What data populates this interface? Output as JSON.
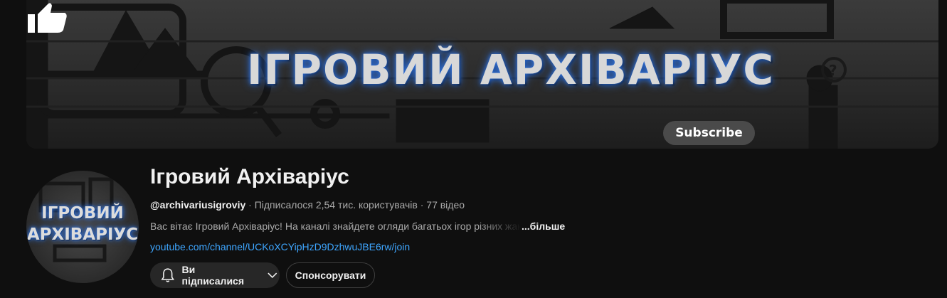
{
  "banner": {
    "title": "ІГРОВИЙ АРХІВАРІУС",
    "subscribe_label": "Subscribe"
  },
  "avatar": {
    "line1": "ІГРОВИЙ",
    "line2": "АРХІВАРІУС"
  },
  "channel": {
    "name": "Ігровий Архіваріус",
    "handle": "@archivariusigroviy",
    "separator": " · ",
    "subscribers": "Підписалося 2,54 тис. користувачів",
    "videos": "77 відео",
    "description": "Вас вітає Ігровий Архіваріус! На каналі знайдете огляди багатьох ігор різних жанрів",
    "more_label": "...більше",
    "link": "youtube.com/channel/UCKoXCYipHzD9DzhwuJBE6rw/join"
  },
  "actions": {
    "subscribed_label": "Ви підписалися",
    "sponsor_label": "Спонсорувати"
  },
  "icons": {
    "bell": "bell-icon",
    "chevron": "chevron-down-icon",
    "thumb": "thumbs-up-icon"
  },
  "colors": {
    "background": "#0f0f0f",
    "link": "#3ea6ff",
    "glow": "#2f6fd8"
  }
}
